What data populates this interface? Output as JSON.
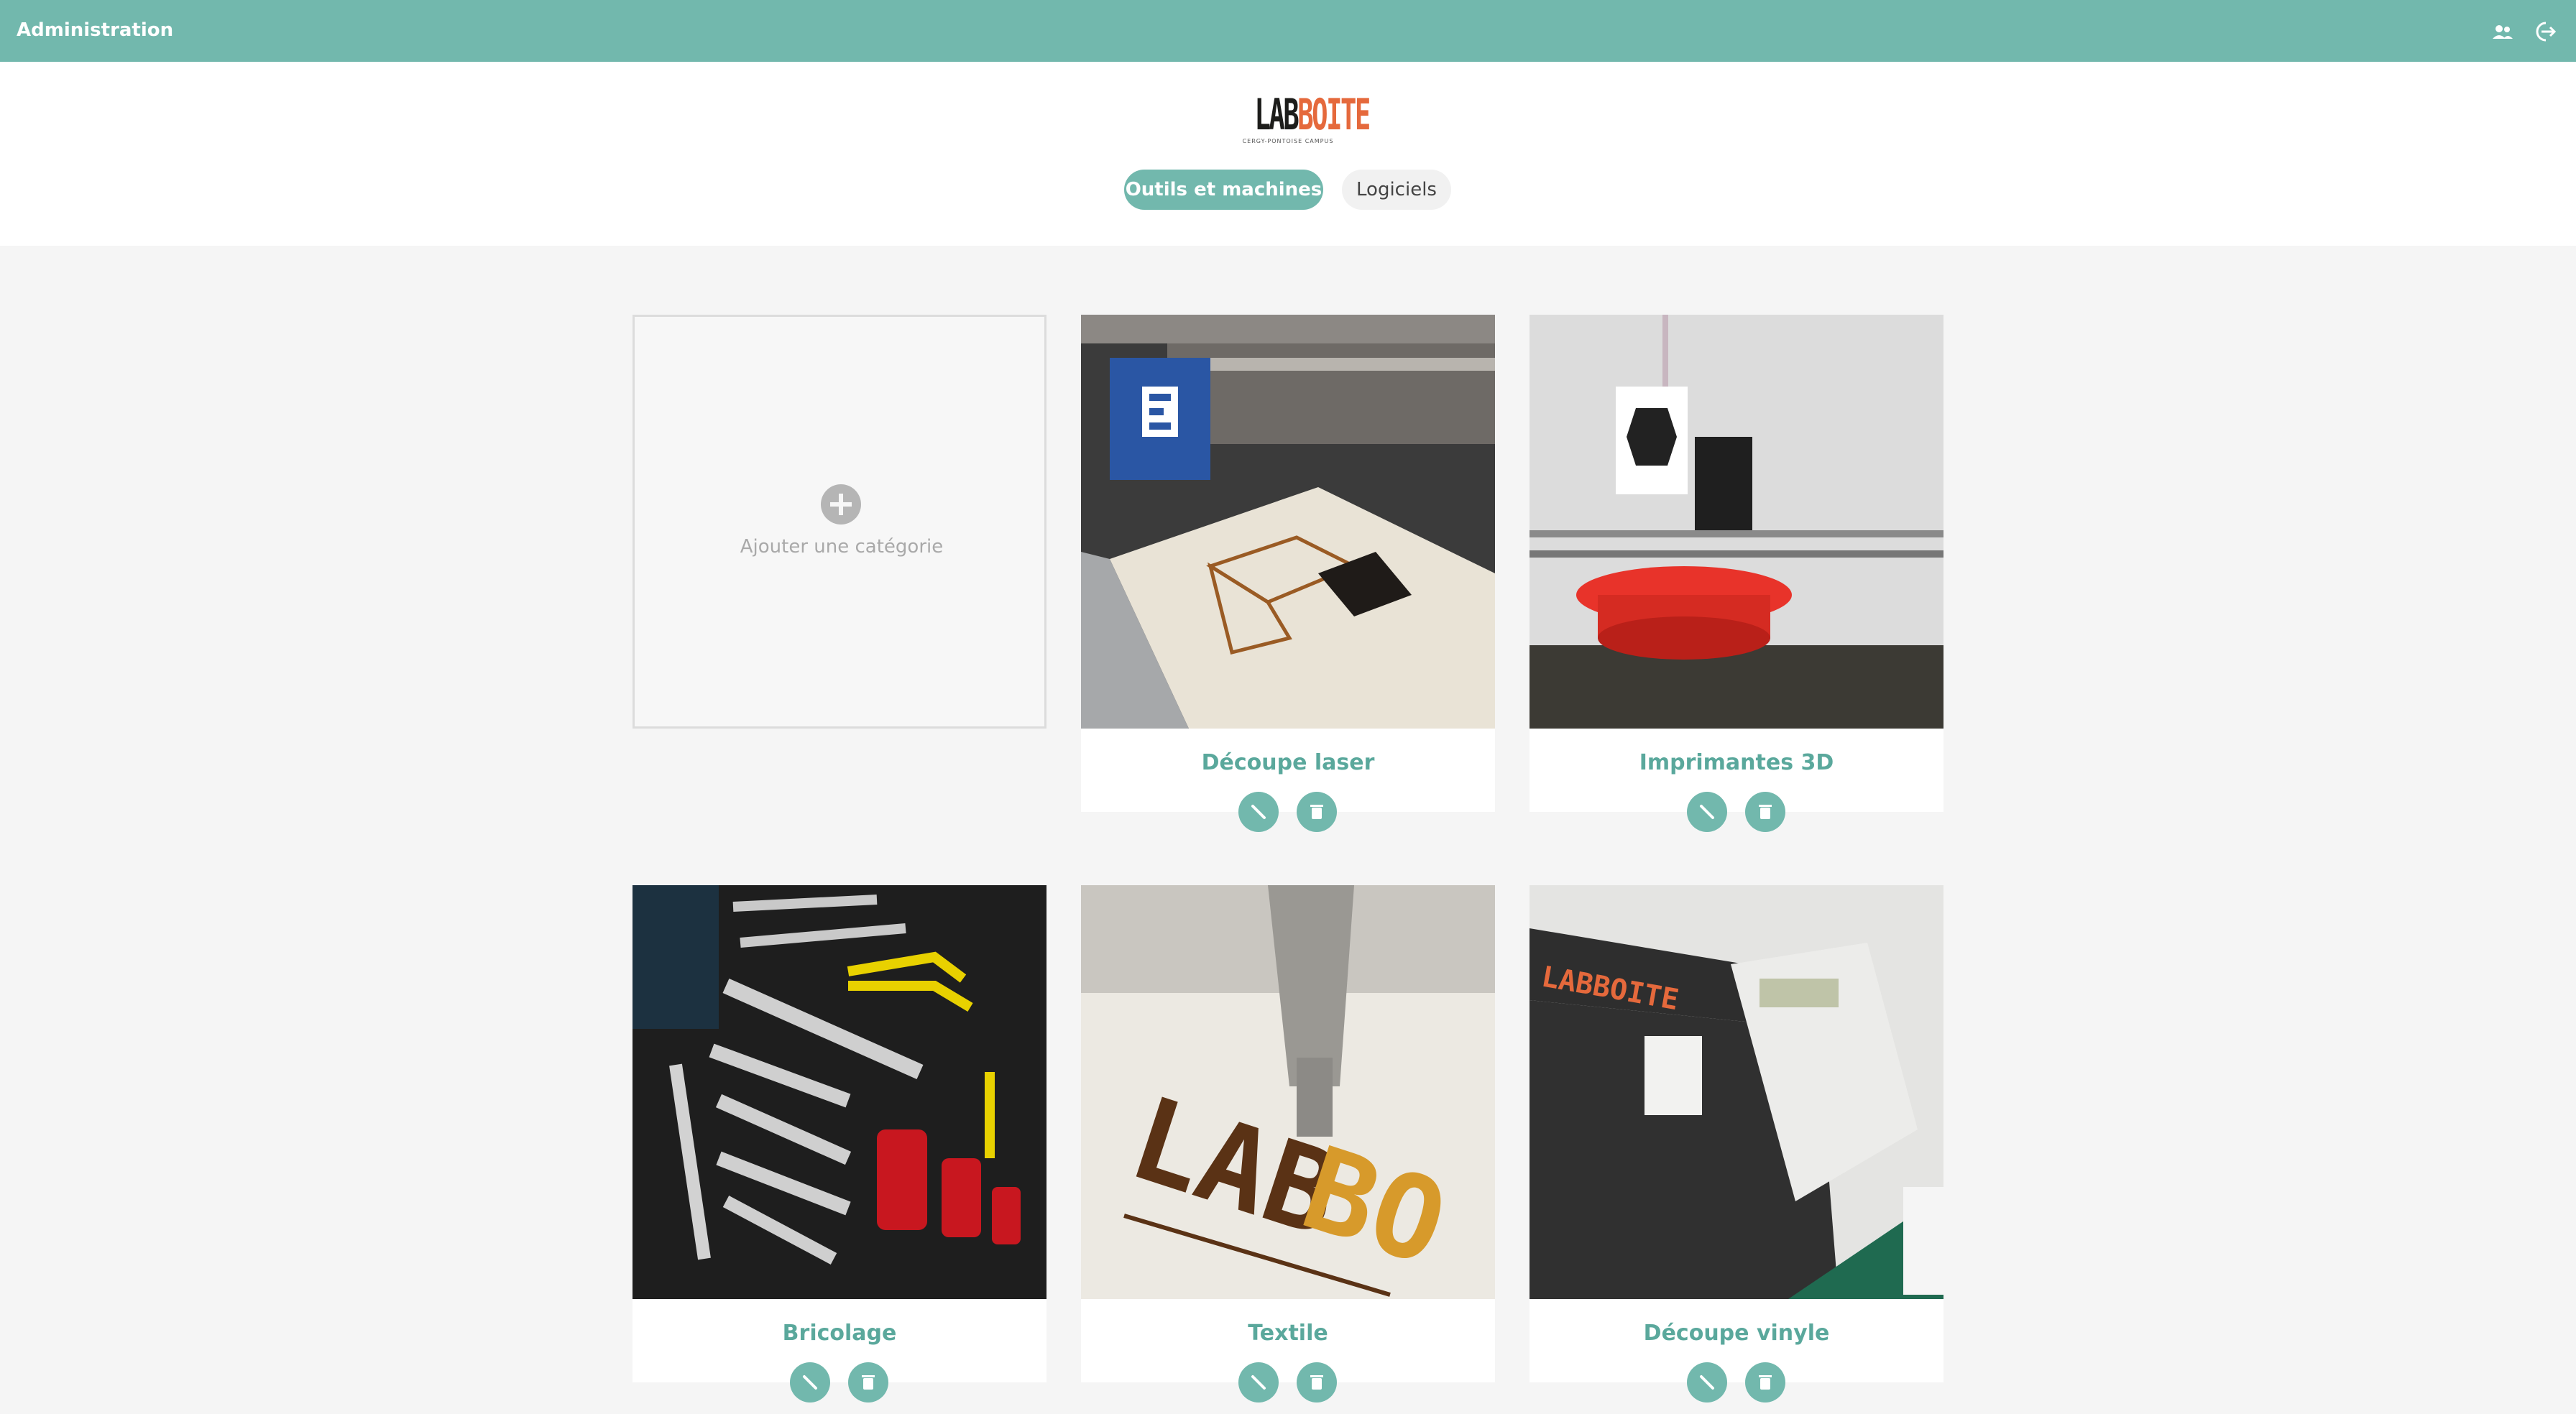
{
  "topbar": {
    "title": "Administration",
    "icons": [
      "users-icon",
      "logout-icon"
    ]
  },
  "logo": {
    "lab": "LAB",
    "boite": "BOITE",
    "subtitle": "CERGY-PONTOISE CAMPUS"
  },
  "tabs": [
    {
      "label": "Outils et machines",
      "active": true
    },
    {
      "label": "Logiciels",
      "active": false
    }
  ],
  "add_category": {
    "label": "Ajouter une catégorie",
    "icon": "plus-circle-icon"
  },
  "categories": [
    {
      "name": "Découpe laser",
      "image": "laser-cutter-photo"
    },
    {
      "name": "Imprimantes 3D",
      "image": "3d-printer-photo"
    },
    {
      "name": "Bricolage",
      "image": "tools-photo"
    },
    {
      "name": "Textile",
      "image": "embroidery-photo"
    },
    {
      "name": "Découpe vinyle",
      "image": "vinyl-cutter-photo"
    }
  ],
  "card_actions": {
    "edit_icon": "pencil-icon",
    "delete_icon": "trash-icon"
  },
  "colors": {
    "accent": "#72b8ad",
    "accent_text": "#5aa89c",
    "background": "#f5f5f5"
  }
}
